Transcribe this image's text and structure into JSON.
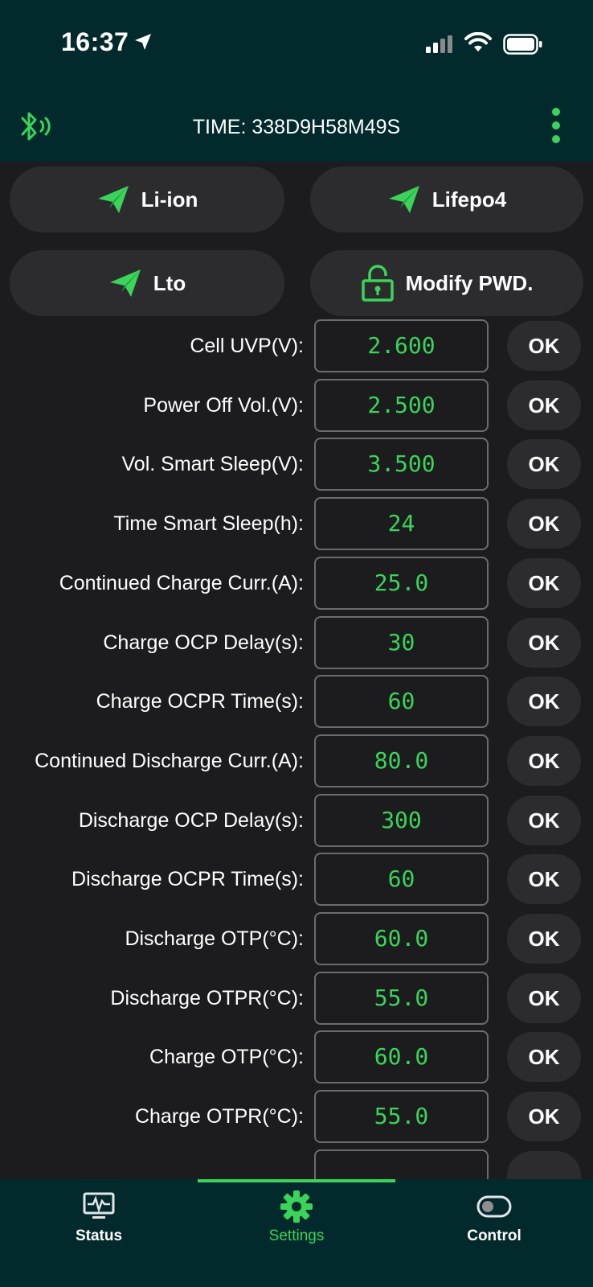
{
  "status_bar": {
    "time": "16:37"
  },
  "header": {
    "title": "TIME: 338D9H58M49S"
  },
  "mode_buttons": [
    {
      "label": "Li-ion",
      "icon": "paper-plane-icon"
    },
    {
      "label": "Lifepo4",
      "icon": "paper-plane-icon"
    },
    {
      "label": "Lto",
      "icon": "paper-plane-icon"
    },
    {
      "label": "Modify PWD.",
      "icon": "lock-open-icon"
    }
  ],
  "ok_label": "OK",
  "settings": [
    {
      "label": "Cell UVP(V):",
      "value": "2.600"
    },
    {
      "label": "Power Off Vol.(V):",
      "value": "2.500"
    },
    {
      "label": "Vol. Smart Sleep(V):",
      "value": "3.500"
    },
    {
      "label": "Time Smart Sleep(h):",
      "value": "24"
    },
    {
      "label": "Continued Charge Curr.(A):",
      "value": "25.0"
    },
    {
      "label": "Charge OCP Delay(s):",
      "value": "30"
    },
    {
      "label": "Charge OCPR Time(s):",
      "value": "60"
    },
    {
      "label": "Continued Discharge Curr.(A):",
      "value": "80.0"
    },
    {
      "label": "Discharge OCP Delay(s):",
      "value": "300"
    },
    {
      "label": "Discharge OCPR Time(s):",
      "value": "60"
    },
    {
      "label": "Discharge OTP(°C):",
      "value": "60.0"
    },
    {
      "label": "Discharge OTPR(°C):",
      "value": "55.0"
    },
    {
      "label": "Charge OTP(°C):",
      "value": "60.0"
    },
    {
      "label": "Charge OTPR(°C):",
      "value": "55.0"
    }
  ],
  "tabs": [
    {
      "label": "Status",
      "icon": "monitor-pulse-icon",
      "active": false
    },
    {
      "label": "Settings",
      "icon": "gear-icon",
      "active": true
    },
    {
      "label": "Control",
      "icon": "toggle-icon",
      "active": false
    }
  ],
  "colors": {
    "accent": "#3ad45a",
    "header_bg": "#022a2c",
    "content_bg": "#1c1c1e",
    "button_bg": "#2c2c2e"
  }
}
